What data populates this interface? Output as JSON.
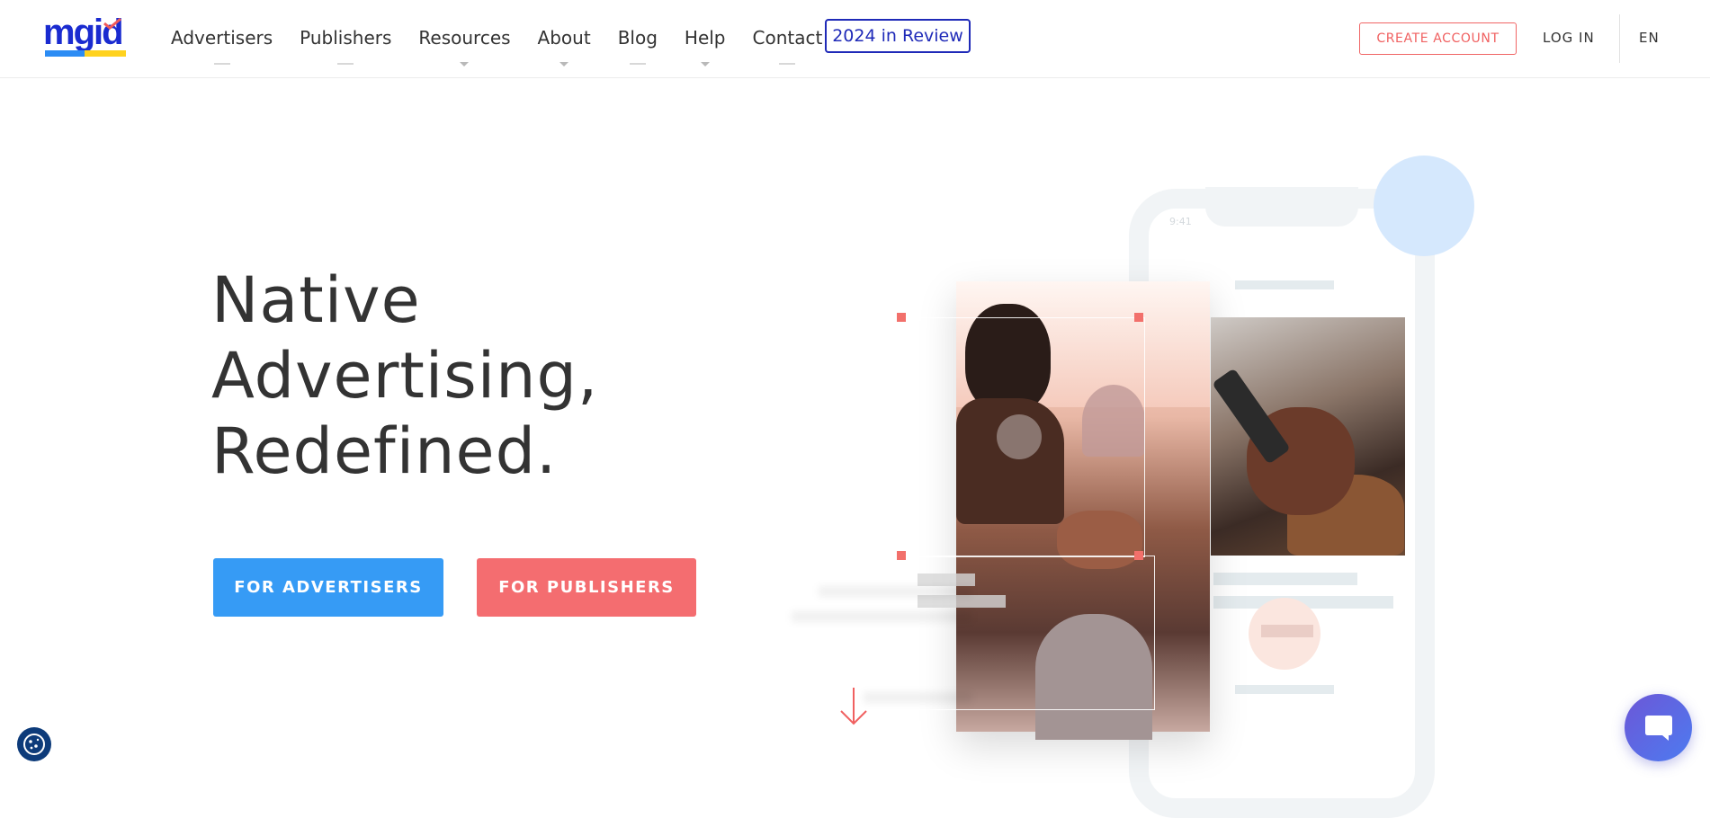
{
  "header": {
    "logo_text": "mgid",
    "nav": [
      {
        "label": "Advertisers",
        "has_dropdown": false
      },
      {
        "label": "Publishers",
        "has_dropdown": false
      },
      {
        "label": "Resources",
        "has_dropdown": true
      },
      {
        "label": "About",
        "has_dropdown": true
      },
      {
        "label": "Blog",
        "has_dropdown": false
      },
      {
        "label": "Help",
        "has_dropdown": true
      },
      {
        "label": "Contact",
        "has_dropdown": false
      }
    ],
    "review_label": "2024 in Review",
    "create_account_label": "CREATE ACCOUNT",
    "login_label": "LOG IN",
    "language": "EN"
  },
  "hero": {
    "title_lines": [
      "Native",
      "Advertising,",
      "Redefined."
    ],
    "advertisers_button": "FOR ADVERTISERS",
    "publishers_button": "FOR PUBLISHERS"
  },
  "illustration": {
    "phone_time": "9:41"
  },
  "colors": {
    "brand_blue": "#1f2ab8",
    "button_blue": "#369bf5",
    "button_coral": "#f46d70",
    "accent_red": "#f06060"
  },
  "icons": {
    "cookie": "cookie-icon",
    "chat": "chat-icon",
    "arrow": "arrow-down-icon"
  }
}
